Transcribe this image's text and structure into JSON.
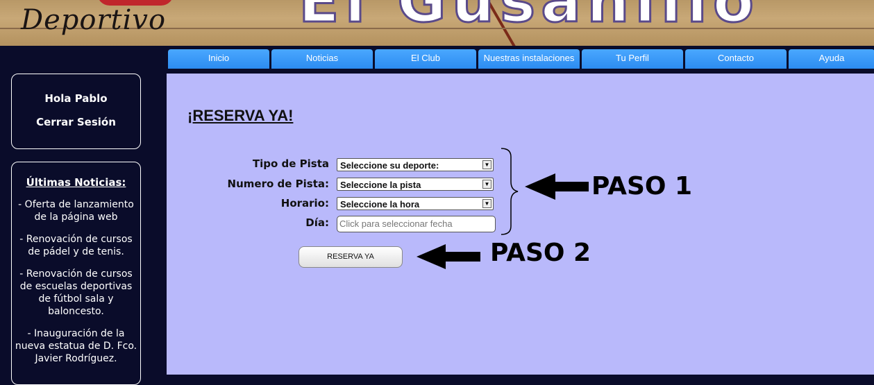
{
  "header": {
    "logo_text": "Deportivo",
    "site_title": "El Gusanillo"
  },
  "nav": {
    "items": [
      "Inicio",
      "Noticias",
      "El Club",
      "Nuestras instalaciones",
      "Tu Perfil",
      "Contacto",
      "Ayuda"
    ]
  },
  "sidebar": {
    "greeting": "Hola Pablo",
    "logout": "Cerrar Sesión",
    "news_title": "Últimas Noticias:",
    "news": [
      "- Oferta de lanzamiento de la página web",
      "- Renovación de cursos de pádel y de tenis.",
      "- Renovación de cursos de escuelas deportivas de fútbol sala y baloncesto.",
      "- Inauguración de la nueva estatua de D. Fco. Javier Rodríguez."
    ]
  },
  "main": {
    "heading": "¡RESERVA YA!",
    "form": {
      "court_type_label": "Tipo de Pista",
      "court_type_value": "Seleccione su deporte:",
      "court_number_label": "Numero de Pista:",
      "court_number_value": "Seleccione la pista",
      "schedule_label": "Horario:",
      "schedule_value": "Seleccione la hora",
      "day_label": "Día:",
      "day_placeholder": "Click para seleccionar fecha"
    },
    "submit_label": "RESERVA YA",
    "step1": "PASO 1",
    "step2": "PASO 2"
  },
  "colors": {
    "nav_blue": "#2c8cf0",
    "content_bg": "#b9b9fb",
    "page_bg": "#0a0c2a"
  }
}
